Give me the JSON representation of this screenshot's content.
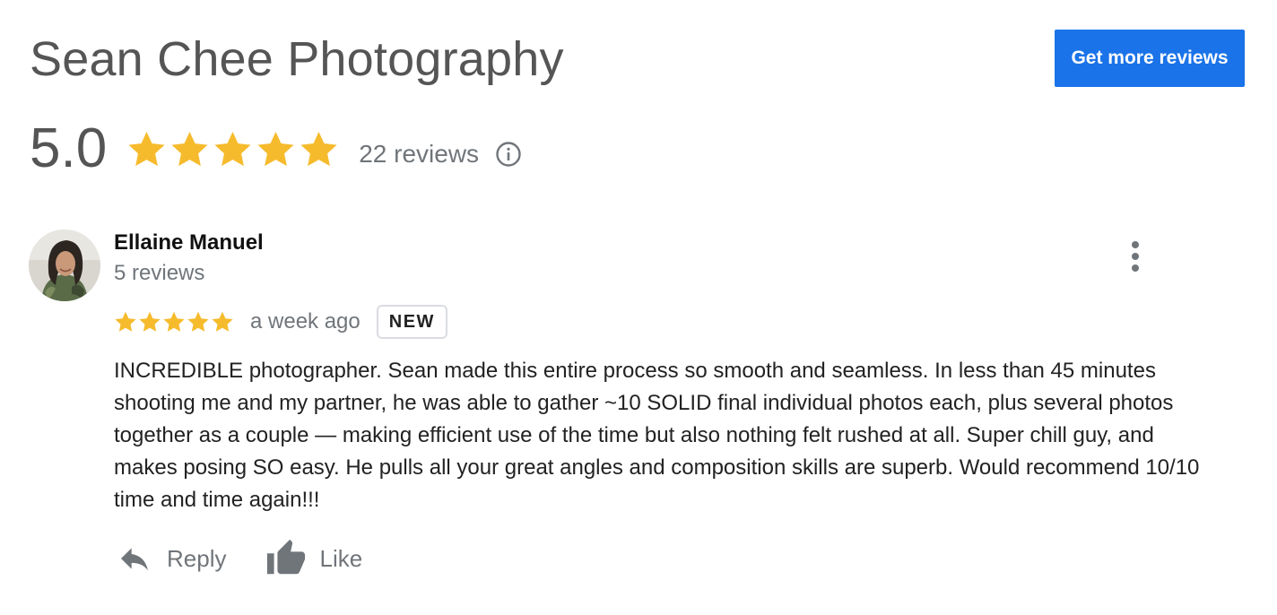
{
  "business": {
    "name": "Sean Chee Photography",
    "cta_label": "Get more reviews"
  },
  "summary": {
    "rating": "5.0",
    "stars": 5,
    "review_count": "22 reviews"
  },
  "review": {
    "author": "Ellaine Manuel",
    "author_review_count": "5 reviews",
    "stars": 5,
    "time": "a week ago",
    "badge": "NEW",
    "text": "INCREDIBLE photographer. Sean made this entire process so smooth and seamless. In less than 45 minutes shooting me and my partner, he was able to gather ~10 SOLID final individual photos each, plus several photos together as a couple — making efficient use of the time but also nothing felt rushed at all. Super chill guy, and makes posing SO easy. He pulls all your great angles and composition skills are superb. Would recommend 10/10 time and time again!!!",
    "actions": {
      "reply": "Reply",
      "like": "Like"
    }
  },
  "icons": {
    "star": "star-icon",
    "info": "info-icon",
    "more": "more-vert-icon",
    "reply": "reply-arrow-icon",
    "like": "thumbs-up-icon"
  },
  "colors": {
    "accent": "#1a73e8",
    "star": "#f6bb2d",
    "muted_text": "#70757a",
    "title_text": "#555555"
  }
}
